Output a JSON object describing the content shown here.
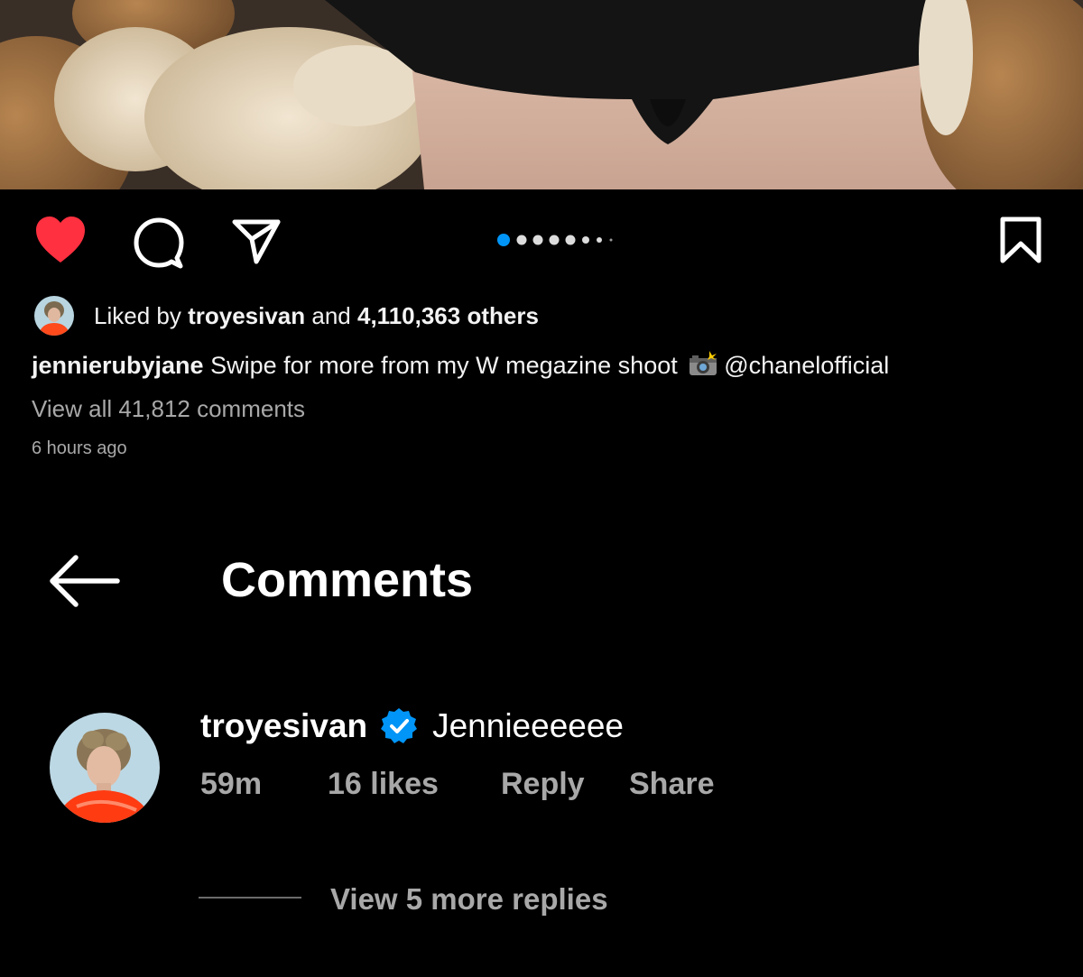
{
  "post": {
    "liked_by_prefix": "Liked by ",
    "liked_by_user": "troyesivan",
    "liked_by_middle": " and ",
    "liked_by_count": "4,110,363 others",
    "caption_user": "jennierubyjane",
    "caption_text": " Swipe for more from my W megazine shoot ",
    "caption_mention": "@chanelofficial",
    "view_all_comments": "View all 41,812 comments",
    "time_ago": "6 hours ago",
    "carousel_index": 1,
    "carousel_total": 8,
    "liked": true
  },
  "icons": {
    "like": "heart-icon",
    "comment": "comment-icon",
    "share": "paper-plane-icon",
    "bookmark": "bookmark-icon",
    "back": "arrow-left-icon",
    "verified": "verified-badge-icon",
    "camera_emoji": "camera-flash-emoji"
  },
  "colors": {
    "like_red": "#ff3040",
    "dot_active": "#0095f6",
    "verified_blue": "#0095f6",
    "secondary_text": "#a8a8a8"
  },
  "comments_header": {
    "title": "Comments"
  },
  "comment": {
    "username": "troyesivan",
    "text": "Jennieeeeee",
    "time": "59m",
    "likes": "16 likes",
    "reply": "Reply",
    "share": "Share",
    "view_replies": "View 5 more replies"
  }
}
